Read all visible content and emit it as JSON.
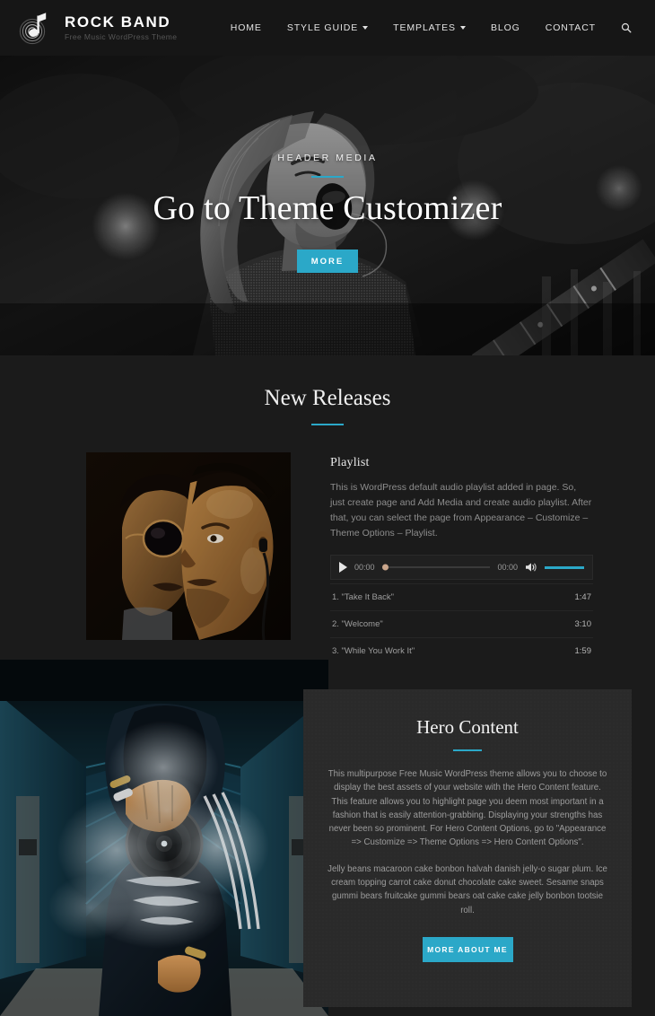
{
  "header": {
    "logo_icon": "music-note-vinyl-icon",
    "brand_title": "ROCK BAND",
    "brand_tagline": "Free Music WordPress Theme",
    "nav": [
      {
        "label": "HOME",
        "has_dropdown": false
      },
      {
        "label": "STYLE GUIDE",
        "has_dropdown": true
      },
      {
        "label": "TEMPLATES",
        "has_dropdown": true
      },
      {
        "label": "BLOG",
        "has_dropdown": false
      },
      {
        "label": "CONTACT",
        "has_dropdown": false
      }
    ],
    "search_icon": "search-icon"
  },
  "hero": {
    "eyebrow": "HEADER MEDIA",
    "title": "Go to Theme Customizer",
    "button_label": "MORE",
    "image_alt": "Black and white photo of a long-haired singer shouting into a microphone with stage bokeh lights and a guitar"
  },
  "new_releases": {
    "title": "New Releases",
    "image_alt": "Sepia-toned photo of two people, one wearing round sunglasses and one wearing earphones",
    "heading": "Playlist",
    "description": "This is WordPress default audio playlist added in page. So, just create page and Add Media and create audio playlist. After that, you can select the page from Appearance – Customize – Theme Options – Playlist.",
    "player": {
      "play_icon": "play-icon",
      "current_time": "00:00",
      "total_time": "00:00",
      "volume_icon": "volume-icon",
      "progress_percent": 0,
      "volume_percent": 100
    },
    "tracks": [
      {
        "label": "1. \"Take It Back\"",
        "duration": "1:47"
      },
      {
        "label": "2. \"Welcome\"",
        "duration": "3:10"
      },
      {
        "label": "3. \"While You Work It\"",
        "duration": "1:59"
      }
    ]
  },
  "hero_content": {
    "image_alt": "Person in a tracksuit holding a camera toward the viewer amid smoke on an escalator",
    "title": "Hero Content",
    "paragraph_1": "This multipurpose Free Music WordPress theme allows you to choose to display the best assets of your website with the Hero Content feature. This feature allows you to highlight page you deem most important in a fashion that is easily attention-grabbing. Displaying your strengths has never been so prominent. For Hero Content Options, go to \"Appearance => Customize => Theme Options => Hero Content Options\".",
    "paragraph_2": "Jelly beans macaroon cake bonbon halvah danish jelly-o sugar plum. Ice cream topping carrot cake donut chocolate cake sweet. Sesame snaps gummi bears fruitcake gummi bears oat cake cake jelly bonbon tootsie roll.",
    "button_label": "MORE ABOUT ME"
  },
  "colors": {
    "accent": "#2ba8c8",
    "page_background": "#1b1b1b",
    "header_background": "#161616",
    "panel_background": "#2a2a2a"
  }
}
